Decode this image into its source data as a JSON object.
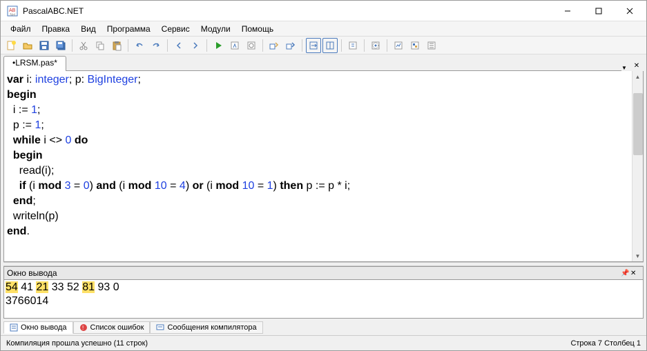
{
  "window": {
    "title": "PascalABC.NET"
  },
  "menu": {
    "items": [
      "Файл",
      "Правка",
      "Вид",
      "Программа",
      "Сервис",
      "Модули",
      "Помощь"
    ]
  },
  "tabs": {
    "active": "•LRSM.pas*"
  },
  "code": {
    "l1a": "var",
    "l1b": " i: ",
    "l1c": "integer",
    "l1d": "; p: ",
    "l1e": "BigInteger",
    "l1f": ";",
    "l2": "begin",
    "l3a": "  i := ",
    "l3b": "1",
    "l3c": ";",
    "l4a": "  p := ",
    "l4b": "1",
    "l4c": ";",
    "l5a": "  ",
    "l5b": "while",
    "l5c": " i <> ",
    "l5d": "0",
    "l5e": " ",
    "l5f": "do",
    "l6a": "  ",
    "l6b": "begin",
    "l7": "    read(i);",
    "l8a": "    ",
    "l8b": "if",
    "l8c": " (i ",
    "l8d": "mod",
    "l8e": " ",
    "l8f": "3",
    "l8g": " = ",
    "l8h": "0",
    "l8i": ") ",
    "l8j": "and",
    "l8k": " (i ",
    "l8l": "mod",
    "l8m": " ",
    "l8n": "10",
    "l8o": " = ",
    "l8p": "4",
    "l8q": ") ",
    "l8r": "or",
    "l8s": " (i ",
    "l8t": "mod",
    "l8u": " ",
    "l8v": "10",
    "l8w": " = ",
    "l8x": "1",
    "l8y": ") ",
    "l8z": "then",
    "l8aa": " p := p * i;",
    "l9a": "  ",
    "l9b": "end",
    "l9c": ";",
    "l10": "  writeln(p)",
    "l11a": "end",
    "l11b": "."
  },
  "outputPanel": {
    "title": "Окно вывода"
  },
  "output": {
    "line1": {
      "h1": "54",
      "s1": " 41 ",
      "h2": "21",
      "s2": " 33 52 ",
      "h3": "81",
      "s3": " 93 0"
    },
    "line2": "3766014"
  },
  "bottomTabs": {
    "t1": "Окно вывода",
    "t2": "Список ошибок",
    "t3": "Сообщения компилятора"
  },
  "status": {
    "left": "Компиляция прошла успешно (11 строк)",
    "right": "Строка  7 Столбец  1"
  }
}
